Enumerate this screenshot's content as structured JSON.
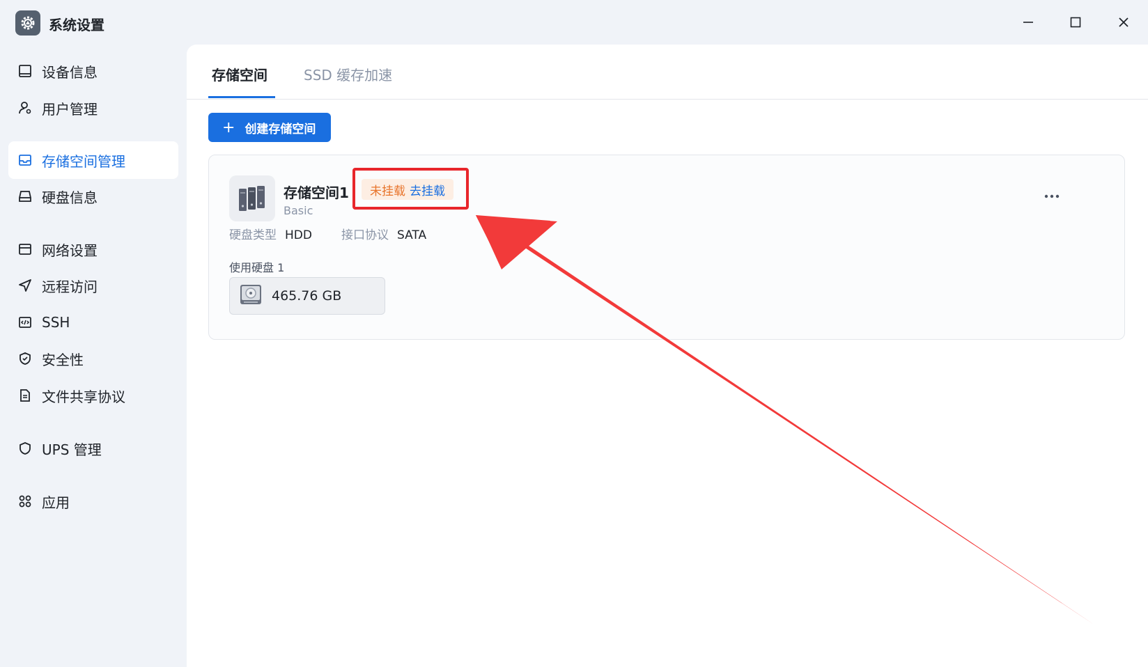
{
  "window": {
    "title": "系统设置",
    "controls": [
      "minimize",
      "maximize",
      "close"
    ]
  },
  "sidebar": {
    "items": [
      {
        "label": "设备信息",
        "icon": "monitor-icon",
        "active": false
      },
      {
        "label": "用户管理",
        "icon": "user-gear-icon",
        "active": false
      },
      {
        "label": "存储空间管理",
        "icon": "storage-inbox-icon",
        "active": true
      },
      {
        "label": "硬盘信息",
        "icon": "hard-drive-icon",
        "active": false
      },
      {
        "label": "网络设置",
        "icon": "network-window-icon",
        "active": false
      },
      {
        "label": "远程访问",
        "icon": "send-icon",
        "active": false
      },
      {
        "label": "SSH",
        "icon": "code-window-icon",
        "active": false
      },
      {
        "label": "安全性",
        "icon": "shield-check-icon",
        "active": false
      },
      {
        "label": "文件共享协议",
        "icon": "document-icon",
        "active": false
      },
      {
        "label": "UPS 管理",
        "icon": "shield-icon",
        "active": false
      },
      {
        "label": "应用",
        "icon": "apps-icon",
        "active": false
      }
    ]
  },
  "tabs": {
    "storage": "存储空间",
    "ssd_cache": "SSD 缓存加速"
  },
  "toolbar": {
    "create_label": "创建存储空间"
  },
  "storage_card": {
    "name": "存储空间1",
    "status": "未挂载",
    "mount_action": "去挂载",
    "raid_type": "Basic",
    "disk_type_label": "硬盘类型",
    "disk_type_value": "HDD",
    "interface_label": "接口协议",
    "interface_value": "SATA",
    "disks_used_label": "使用硬盘 1",
    "disk_size": "465.76 GB"
  },
  "colors": {
    "accent": "#1a6fe0",
    "warning": "#e8742b",
    "annotation_red": "#e8262b"
  }
}
